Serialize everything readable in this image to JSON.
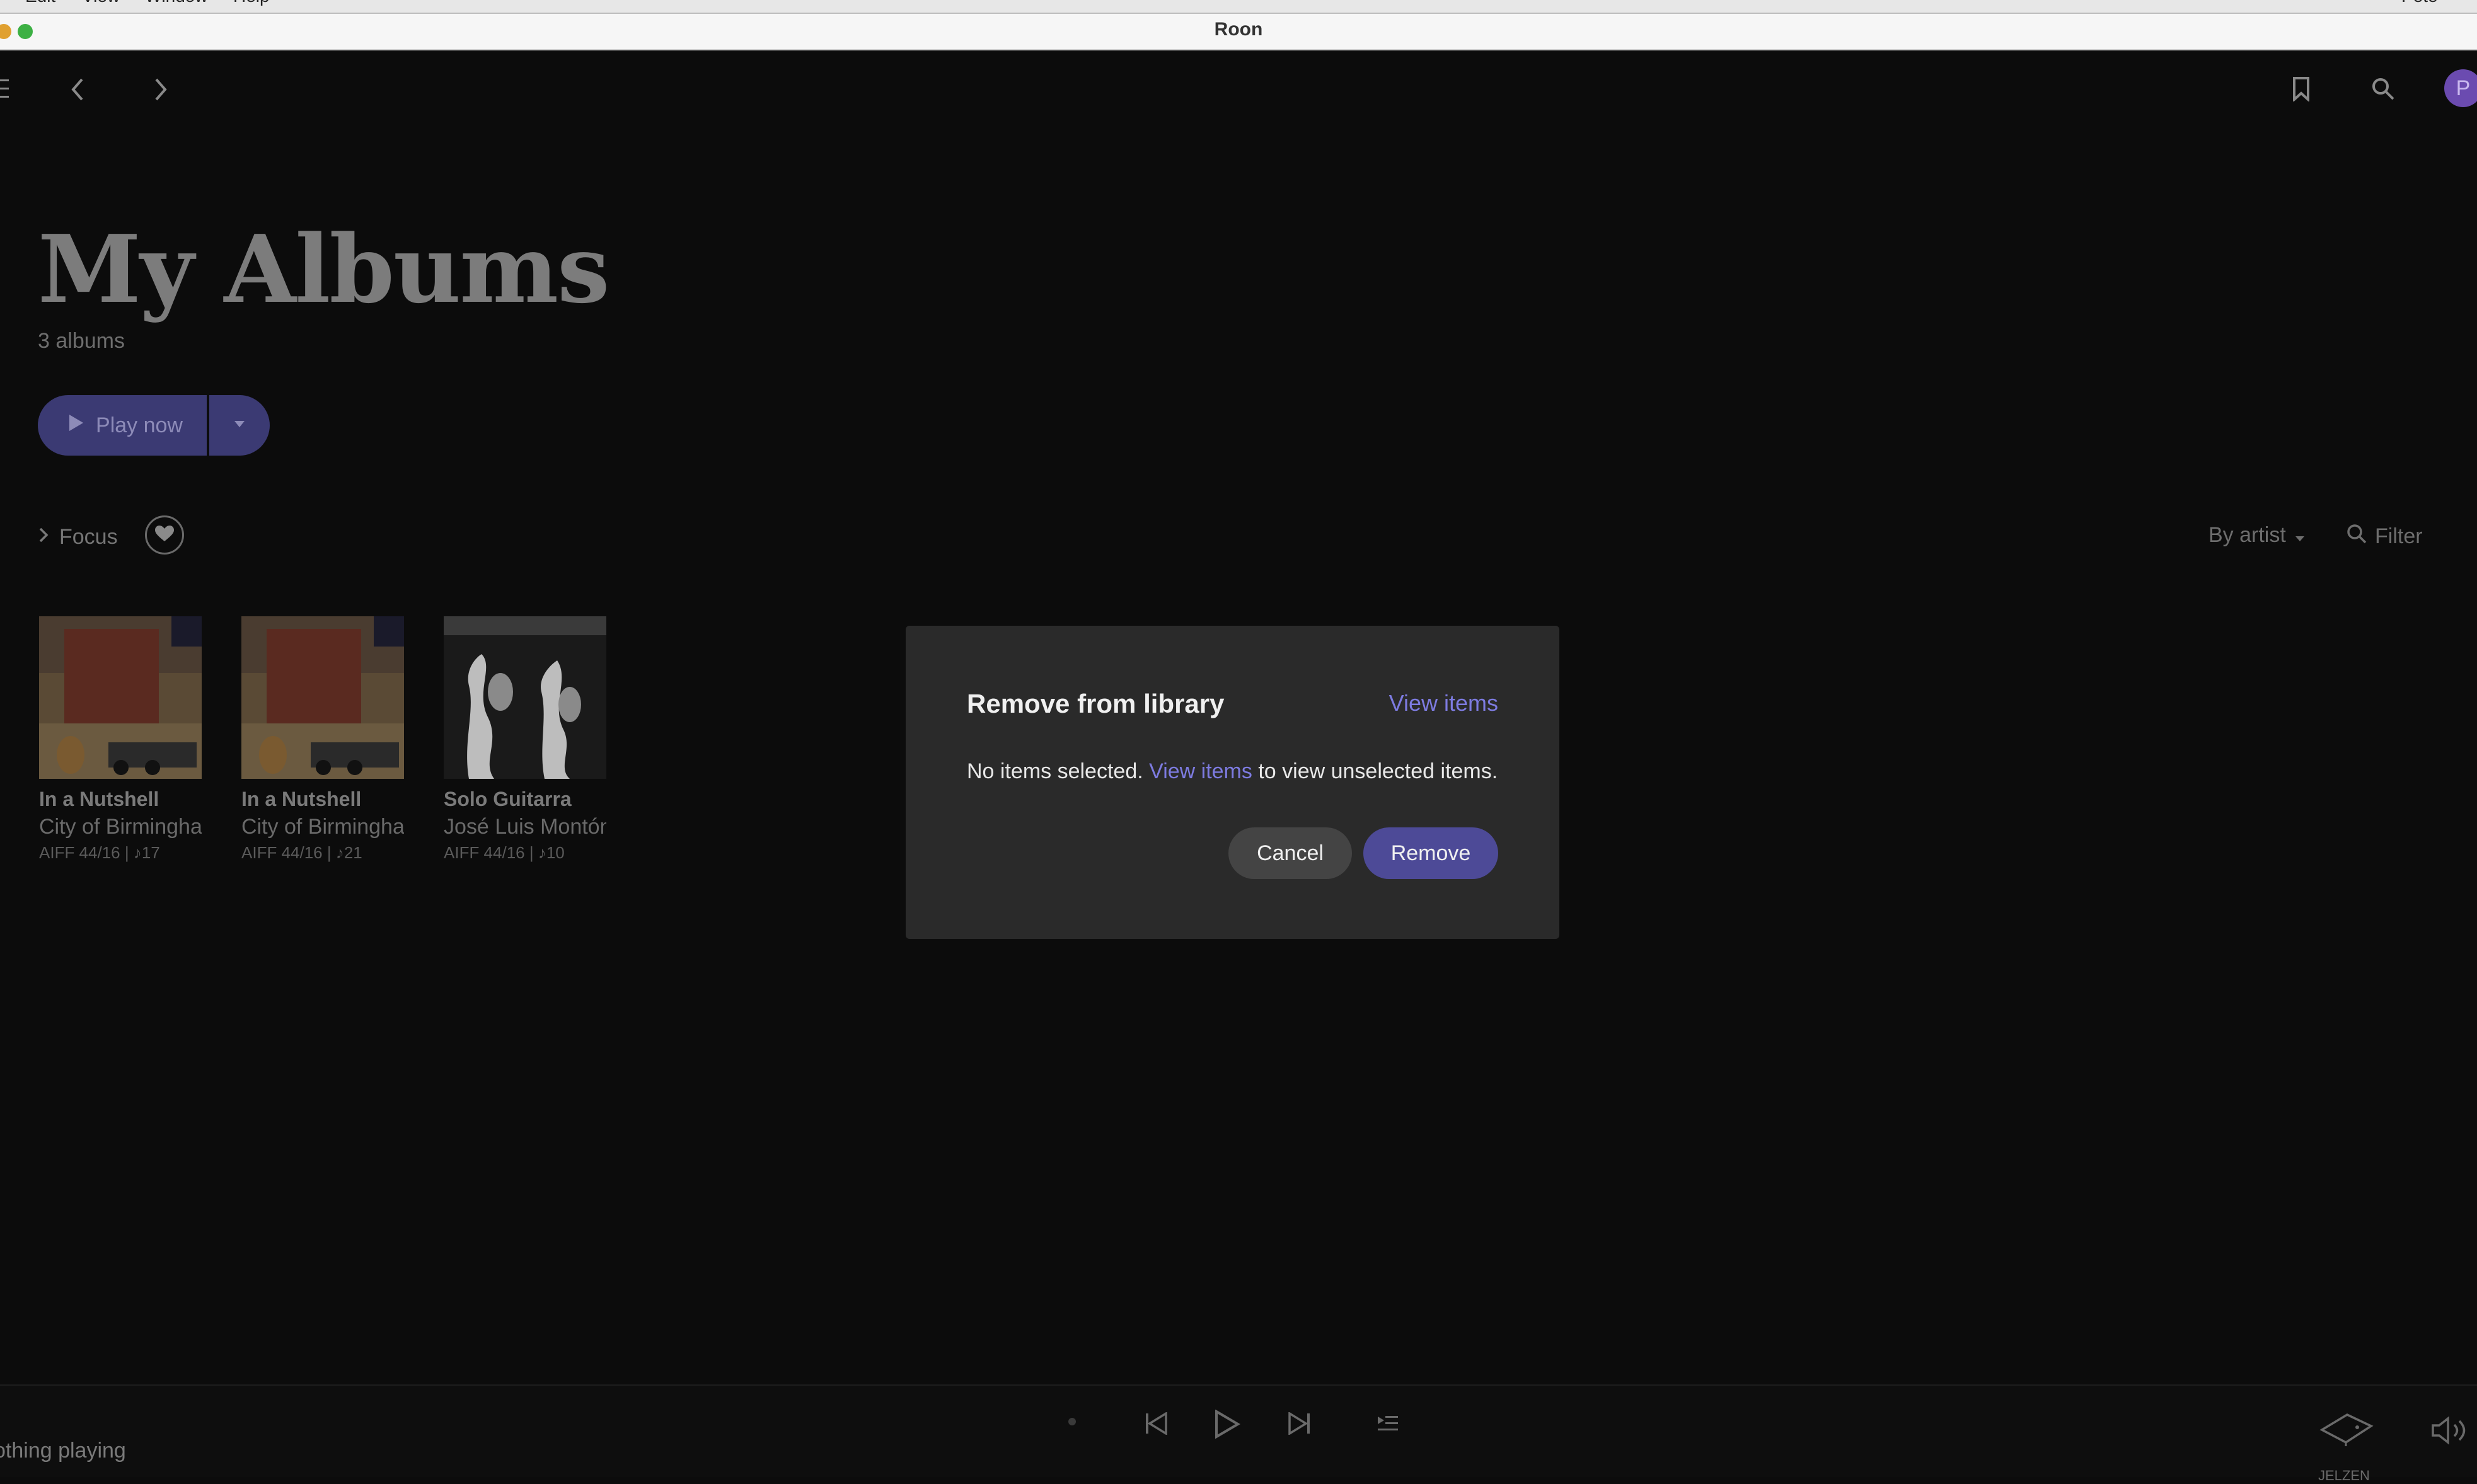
{
  "menubar": {
    "items": [
      "Edit",
      "View",
      "Window",
      "Help"
    ],
    "user": "Pete"
  },
  "window": {
    "title": "Roon"
  },
  "header": {
    "menu_icon": "hamburger-icon",
    "back_icon": "chevron-left-icon",
    "forward_icon": "chevron-right-icon",
    "bookmark_icon": "bookmark-icon",
    "search_icon": "search-icon",
    "profile_initial": "P",
    "profile_color": "#6b4bb0"
  },
  "page": {
    "title": "My Albums",
    "count": "3 albums",
    "play_label": "Play now",
    "focus_label": "Focus",
    "sort_label": "By artist",
    "filter_label": "Filter"
  },
  "albums": [
    {
      "title": "In a Nutshell",
      "artist": "City of Birmingham",
      "format": "AIFF 44/16 | ♪17"
    },
    {
      "title": "In a Nutshell",
      "artist": "City of Birmingham",
      "format": "AIFF 44/16 | ♪21"
    },
    {
      "title": "Solo Guitarra",
      "artist": "José Luis Montón",
      "format": "AIFF 44/16 | ♪10"
    }
  ],
  "modal": {
    "title": "Remove from library",
    "view_items": "View items",
    "body_before": "No items selected.",
    "body_link": "View items",
    "body_after": "to view unselected items.",
    "cancel_label": "Cancel",
    "remove_label": "Remove"
  },
  "footer": {
    "now_playing": "othing playing",
    "zone_label": "JELZEN"
  },
  "colors": {
    "accent": "#4d4a97",
    "link": "#7d7be0",
    "background": "#0c0c0c"
  }
}
